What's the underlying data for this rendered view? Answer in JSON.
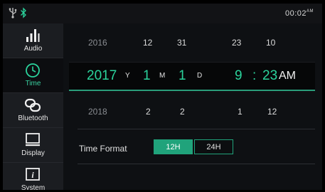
{
  "status": {
    "time": "00:02",
    "ampm": "AM"
  },
  "sidebar": {
    "items": [
      {
        "label": "Audio",
        "icon": "equalizer-icon"
      },
      {
        "label": "Time",
        "icon": "clock-icon"
      },
      {
        "label": "Bluetooth",
        "icon": "link-icon"
      },
      {
        "label": "Display",
        "icon": "monitor-icon"
      },
      {
        "label": "System",
        "icon": "info-icon"
      }
    ]
  },
  "picker": {
    "prev": {
      "year": "2016",
      "month": "12",
      "day": "31",
      "hour": "23",
      "minute": "10"
    },
    "current": {
      "year": "2017",
      "year_unit": "Y",
      "month": "1",
      "month_unit": "M",
      "day": "1",
      "day_unit": "D",
      "hour": "9",
      "colon": ":",
      "minute": "23",
      "ampm": "AM"
    },
    "next": {
      "year": "2018",
      "month": "2",
      "day": "2",
      "hour": "1",
      "minute": "12"
    }
  },
  "time_format": {
    "label": "Time Format",
    "options": [
      "12H",
      "24H"
    ],
    "selected": "12H"
  },
  "colors": {
    "accent": "#2bd39c",
    "button_active": "#20a37b",
    "sidebar_bg": "#1b1d21"
  }
}
